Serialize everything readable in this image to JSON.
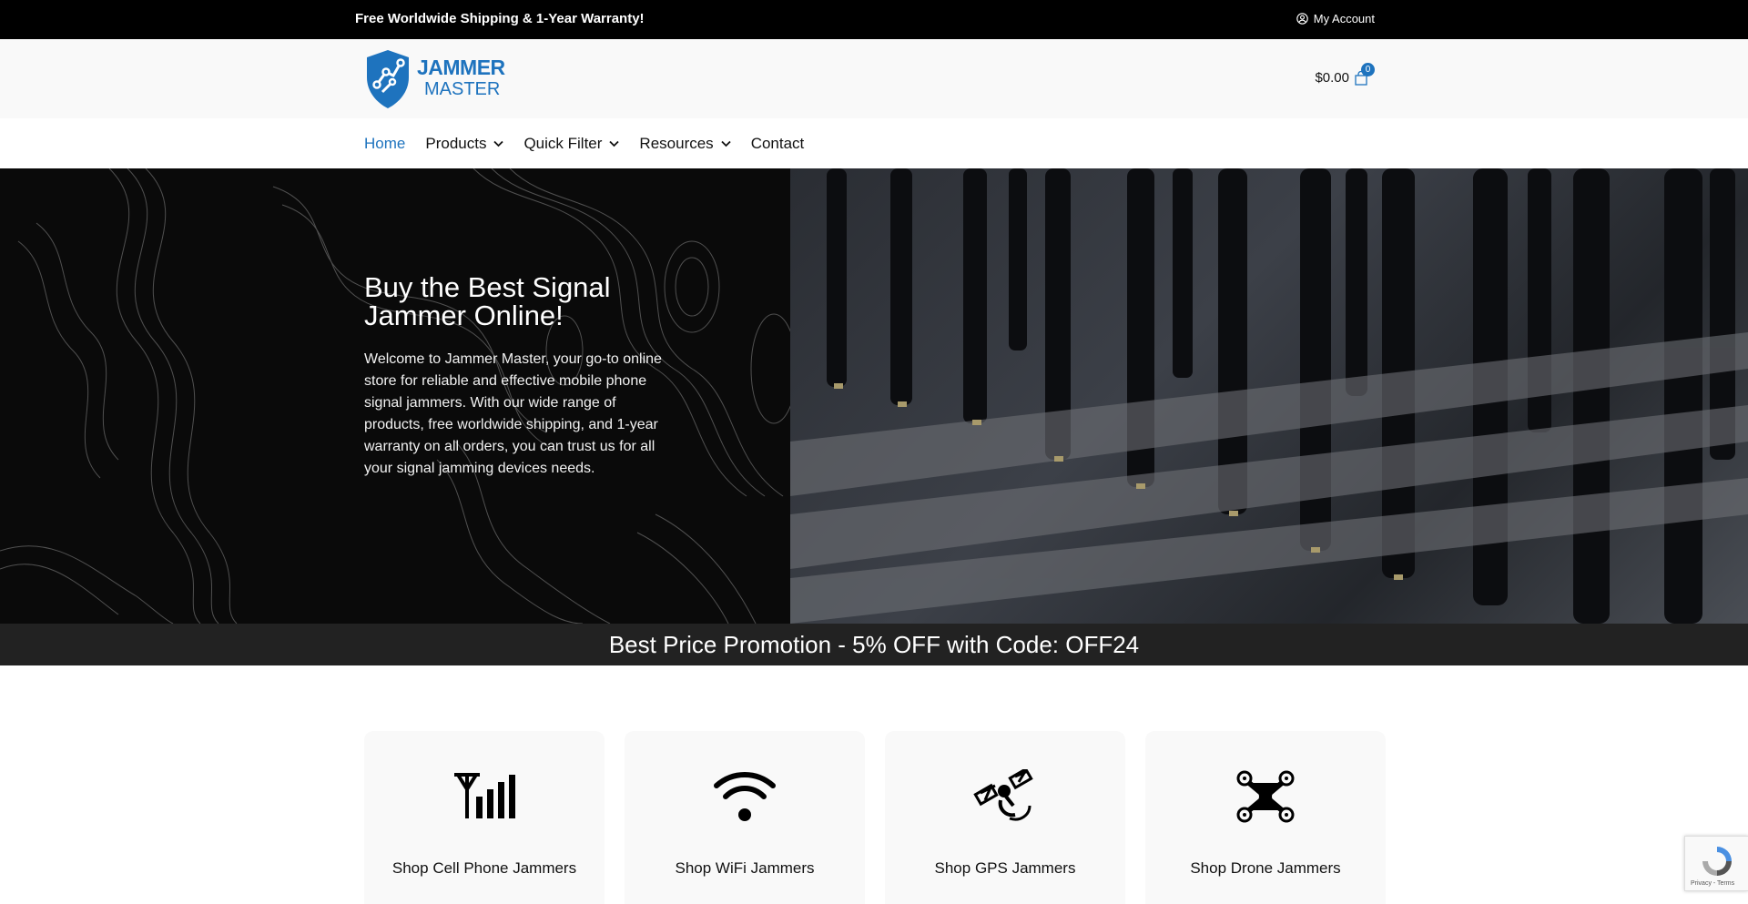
{
  "topbar": {
    "message": "Free Worldwide Shipping & 1-Year Warranty!",
    "account_label": "My Account",
    "account_icon": "user-circle-icon"
  },
  "header": {
    "logo_line1": "JAMMER",
    "logo_line2": "MASTER",
    "cart_total": "$0.00",
    "cart_count": "0"
  },
  "nav": {
    "items": [
      {
        "label": "Home",
        "active": true,
        "dropdown": false
      },
      {
        "label": "Products",
        "active": false,
        "dropdown": true
      },
      {
        "label": "Quick Filter",
        "active": false,
        "dropdown": true
      },
      {
        "label": "Resources",
        "active": false,
        "dropdown": true
      },
      {
        "label": "Contact",
        "active": false,
        "dropdown": false
      }
    ]
  },
  "hero": {
    "title": "Buy the Best Signal Jammer Online!",
    "body": "Welcome to Jammer Master, your go-to online store for reliable and effective mobile phone signal jammers. With our wide range of products, free worldwide shipping, and 1-year warranty on all orders, you can trust us for all your signal jamming devices needs."
  },
  "promo": {
    "text": "Best Price Promotion - 5% OFF with Code: OFF24"
  },
  "categories": [
    {
      "label": "Shop Cell Phone Jammers",
      "icon": "cell-signal-icon"
    },
    {
      "label": "Shop WiFi Jammers",
      "icon": "wifi-icon"
    },
    {
      "label": "Shop GPS Jammers",
      "icon": "satellite-icon"
    },
    {
      "label": "Shop Drone Jammers",
      "icon": "drone-icon"
    }
  ],
  "recaptcha": {
    "footer": "Privacy - Terms"
  },
  "colors": {
    "brand": "#1e73be",
    "topbar": "#000000",
    "promo_bg": "#222222"
  }
}
